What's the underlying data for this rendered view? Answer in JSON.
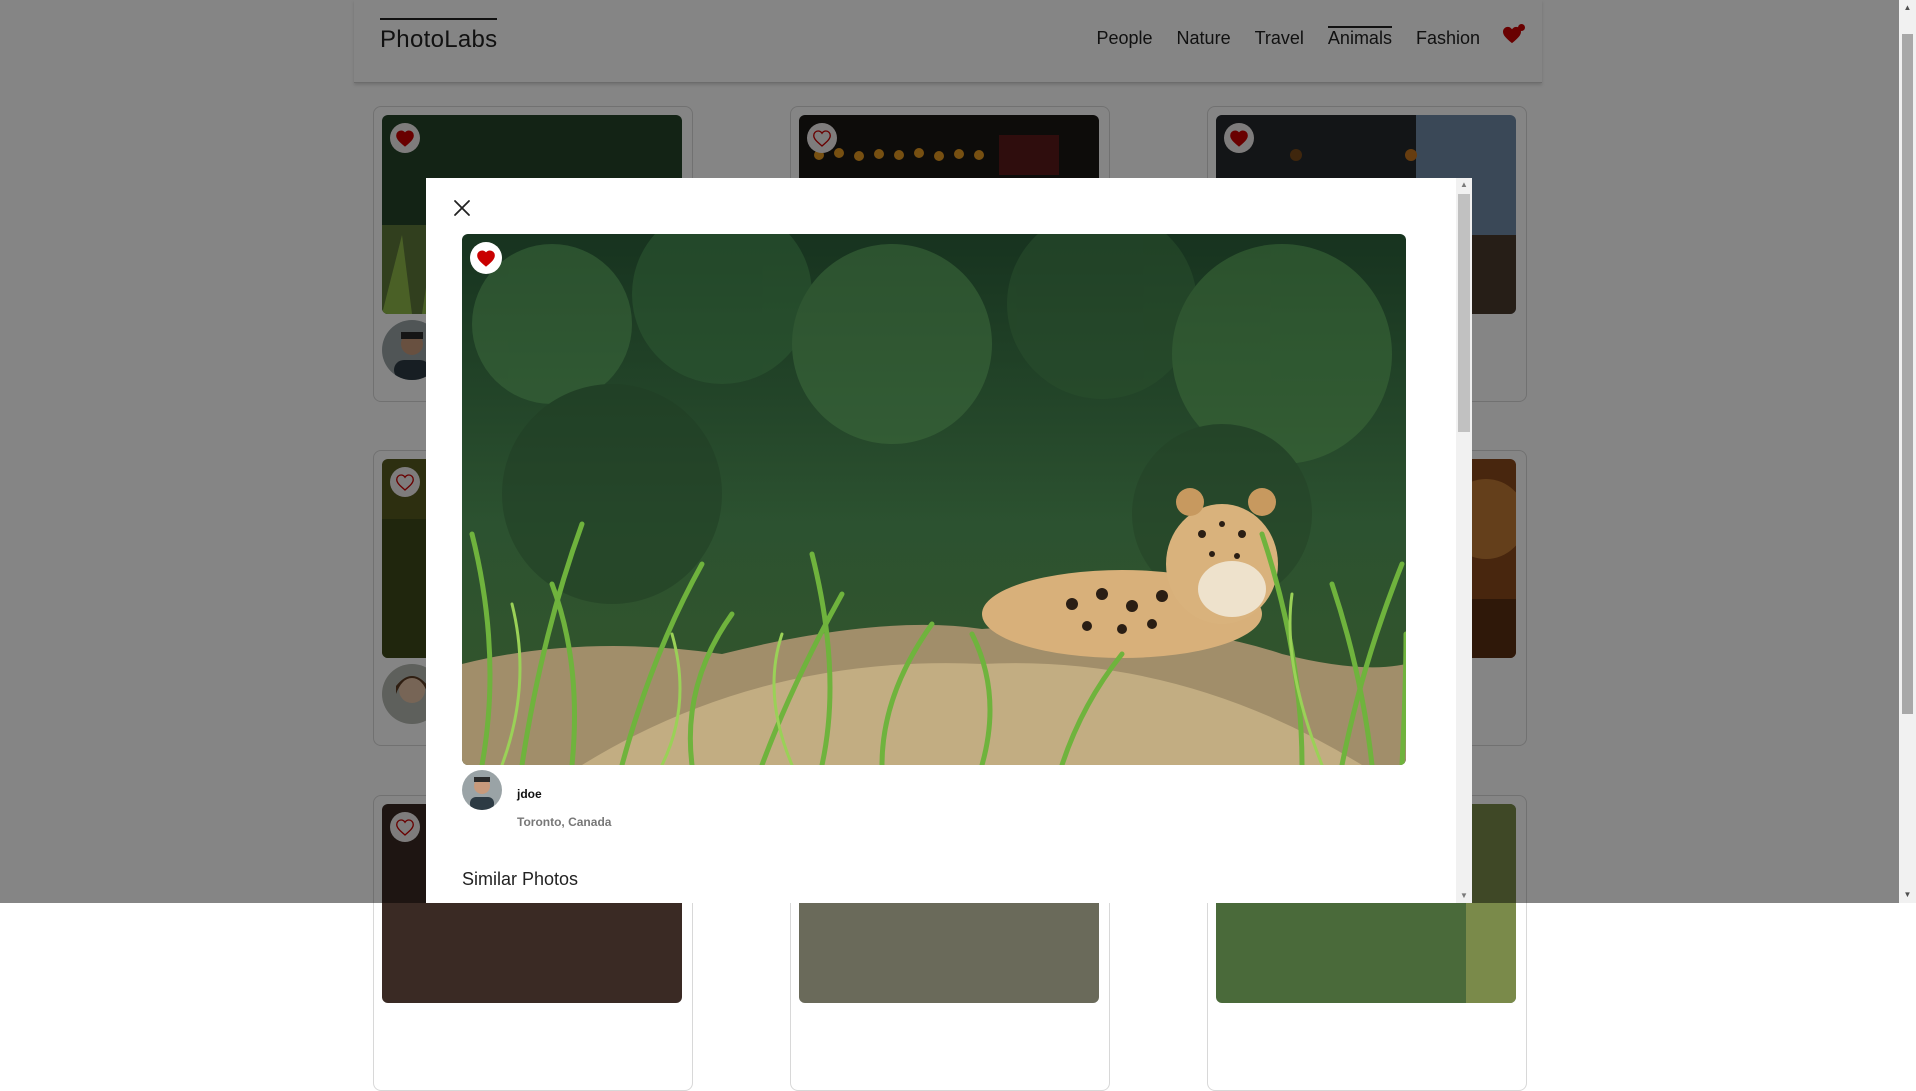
{
  "app": {
    "logo": "PhotoLabs"
  },
  "nav": {
    "topics": [
      "People",
      "Nature",
      "Travel",
      "Animals",
      "Fashion"
    ],
    "active_topic": "Animals",
    "favorites_icon": "heart-icon",
    "has_favorites": true
  },
  "grid": {
    "cards": [
      {
        "favorited": true
      },
      {
        "favorited": false
      },
      {
        "favorited": true
      },
      {
        "favorited": false
      },
      {
        "favorited": false
      },
      {
        "favorited": false
      },
      {
        "favorited": false
      },
      {
        "favorited": false
      },
      {
        "favorited": false
      }
    ]
  },
  "modal": {
    "close_icon": "close-icon",
    "photo": {
      "favorited": true
    },
    "owner": {
      "username": "jdoe",
      "location": "Toronto, Canada"
    },
    "similar_title": "Similar Photos"
  },
  "colors": {
    "heart_fill": "#c90000",
    "overlay": "rgba(0,0,0,0.48)"
  }
}
